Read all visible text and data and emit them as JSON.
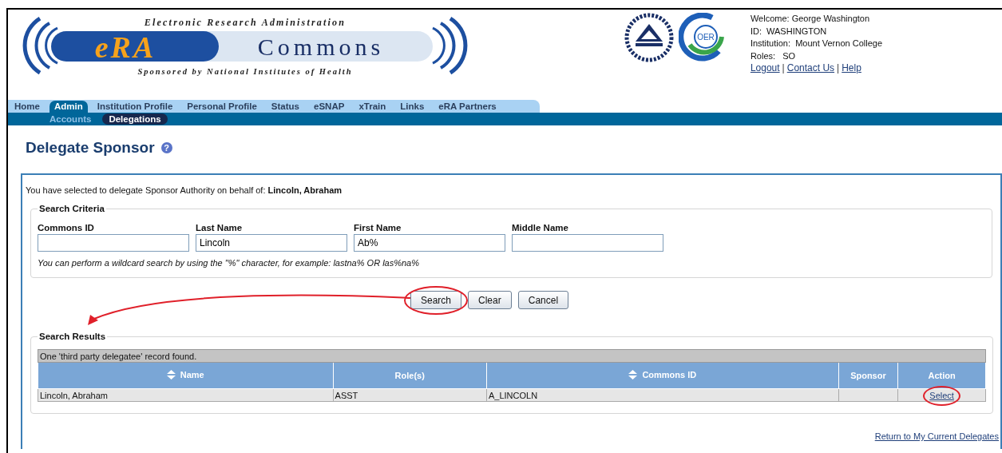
{
  "header": {
    "logo": {
      "tagline": "Electronic Research Administration",
      "mark": "eRA",
      "name": "Commons",
      "subtitle": "Sponsored by National Institutes of Health"
    },
    "partner_logo": "OER",
    "user": [
      "Welcome: George Washington",
      "ID:  WASHINGTON",
      "Institution:  Mount Vernon College",
      "Roles:   SO"
    ],
    "links": [
      {
        "kind": "link",
        "label": "Logout"
      },
      {
        "kind": "separator",
        "label": "|"
      },
      {
        "kind": "link",
        "label": "Contact Us"
      },
      {
        "kind": "separator",
        "label": "|"
      },
      {
        "kind": "link",
        "label": "Help"
      }
    ]
  },
  "tabs": [
    {
      "label": "Home",
      "selected": false
    },
    {
      "label": "Admin",
      "selected": true
    },
    {
      "label": "Institution Profile",
      "selected": false
    },
    {
      "label": "Personal Profile",
      "selected": false
    },
    {
      "label": "Status",
      "selected": false
    },
    {
      "label": "eSNAP",
      "selected": false
    },
    {
      "label": "xTrain",
      "selected": false
    },
    {
      "label": "Links",
      "selected": false
    },
    {
      "label": "eRA Partners",
      "selected": false
    }
  ],
  "subtabs": [
    {
      "label": "Accounts",
      "selected": false
    },
    {
      "label": "Delegations",
      "selected": true
    }
  ],
  "page": {
    "title": "Delegate Sponsor",
    "help": "?"
  },
  "intro": "You have selected to delegate Sponsor Authority on behalf of: **Lincoln, Abraham**",
  "search_criteria": {
    "legend": "Search Criteria",
    "fields": [
      {
        "label": "Commons ID"
      },
      {
        "label": "Last Name",
        "value": "Lincoln"
      },
      {
        "label": "First Name",
        "value": "Ab%"
      },
      {
        "label": "Middle Name"
      }
    ],
    "hint": "You can perform a wildcard search by using the \"%\" character, for example: lastna% OR las%na%"
  },
  "buttons": [
    {
      "label": "Search",
      "circled": true
    },
    {
      "label": "Clear",
      "circled": false
    },
    {
      "label": "Cancel",
      "circled": false
    }
  ],
  "callout_arrow": true,
  "search_results": {
    "legend": "Search Results",
    "caption": "One 'third party delegatee' record found.",
    "columns": [
      {
        "label": "Name",
        "sortable": true
      },
      {
        "label": "Role(s)",
        "sortable": false
      },
      {
        "label": "Commons ID",
        "sortable": true
      },
      {
        "label": "Sponsor",
        "sortable": false
      },
      {
        "label": "Action",
        "sortable": false
      }
    ],
    "rows": [
      {
        "name": "Lincoln, Abraham",
        "roles": "ASST",
        "commons_id": "A_LINCOLN",
        "action": {
          "label": "Select",
          "circled": true
        }
      }
    ]
  },
  "return_link": "Return to My Current Delegates"
}
